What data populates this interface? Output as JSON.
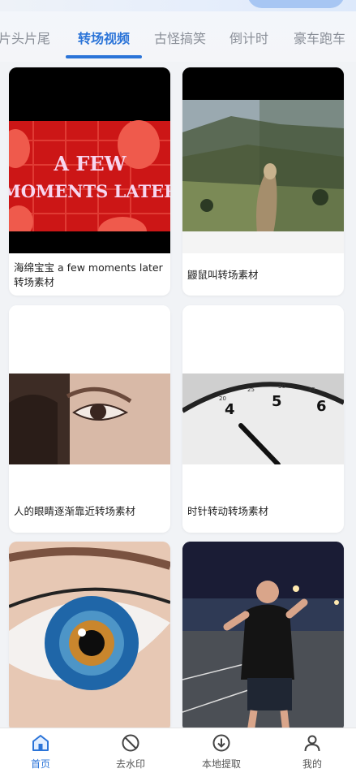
{
  "tabs": [
    {
      "label": "片头片尾",
      "active": false
    },
    {
      "label": "转场视频",
      "active": true
    },
    {
      "label": "古怪搞笑",
      "active": false
    },
    {
      "label": "倒计时",
      "active": false
    },
    {
      "label": "豪车跑车",
      "active": false
    }
  ],
  "cards": [
    {
      "title": "海绵宝宝 a few moments later转场素材",
      "thumb_text": [
        "A FEW",
        "MOMENTS LATER"
      ]
    },
    {
      "title": "鼹鼠叫转场素材"
    },
    {
      "title": "人的眼睛逐渐靠近转场素材"
    },
    {
      "title": "时针转动转场素材",
      "clock_numbers": [
        "20",
        "25",
        "30",
        "35",
        "4",
        "5",
        "6"
      ]
    },
    {
      "title": ""
    },
    {
      "title": ""
    }
  ],
  "bottom_nav": [
    {
      "label": "首页",
      "icon": "home-icon",
      "active": true
    },
    {
      "label": "去水印",
      "icon": "prohibit-icon",
      "active": false
    },
    {
      "label": "本地提取",
      "icon": "download-circle-icon",
      "active": false
    },
    {
      "label": "我的",
      "icon": "person-icon",
      "active": false
    }
  ],
  "colors": {
    "accent": "#2b74d8",
    "background": "#f1f3f6"
  }
}
